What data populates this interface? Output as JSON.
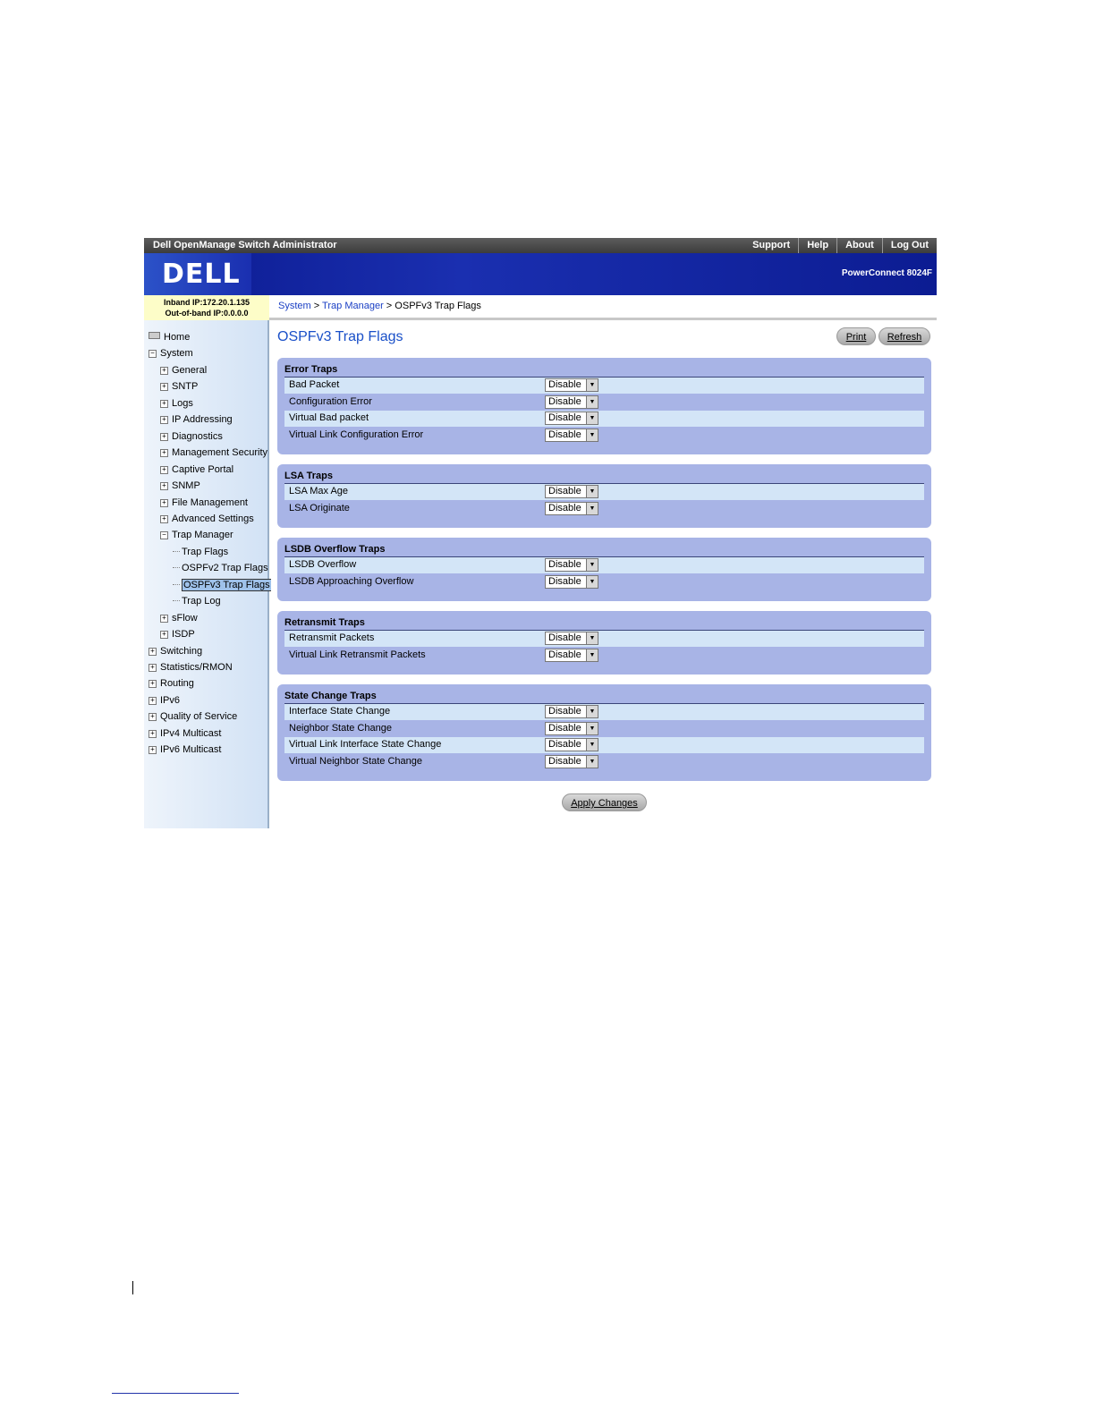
{
  "topbar": {
    "title": "Dell OpenManage Switch Administrator",
    "links": [
      "Support",
      "Help",
      "About",
      "Log Out"
    ]
  },
  "banner": {
    "logo": "DELL",
    "model": "PowerConnect 8024F"
  },
  "ip": {
    "inband": "Inband IP:172.20.1.135",
    "outofband": "Out-of-band IP:0.0.0.0"
  },
  "breadcrumb": {
    "items": [
      "System",
      "Trap Manager",
      "OSPFv3 Trap Flags"
    ],
    "separator": ">"
  },
  "nav": {
    "items": [
      {
        "label": "Home",
        "level": 0,
        "icon": "home-icon"
      },
      {
        "label": "System",
        "level": 0,
        "expanded": true
      },
      {
        "label": "General",
        "level": 1
      },
      {
        "label": "SNTP",
        "level": 1
      },
      {
        "label": "Logs",
        "level": 1
      },
      {
        "label": "IP Addressing",
        "level": 1
      },
      {
        "label": "Diagnostics",
        "level": 1
      },
      {
        "label": "Management Security",
        "level": 1
      },
      {
        "label": "Captive Portal",
        "level": 1
      },
      {
        "label": "SNMP",
        "level": 1
      },
      {
        "label": "File Management",
        "level": 1
      },
      {
        "label": "Advanced Settings",
        "level": 1
      },
      {
        "label": "Trap Manager",
        "level": 1,
        "expanded": true
      },
      {
        "label": "Trap Flags",
        "level": 2
      },
      {
        "label": "OSPFv2 Trap Flags",
        "level": 2
      },
      {
        "label": "OSPFv3 Trap Flags",
        "level": 2,
        "selected": true
      },
      {
        "label": "Trap Log",
        "level": 2
      },
      {
        "label": "sFlow",
        "level": 1
      },
      {
        "label": "ISDP",
        "level": 1
      },
      {
        "label": "Switching",
        "level": 0
      },
      {
        "label": "Statistics/RMON",
        "level": 0
      },
      {
        "label": "Routing",
        "level": 0
      },
      {
        "label": "IPv6",
        "level": 0
      },
      {
        "label": "Quality of Service",
        "level": 0
      },
      {
        "label": "IPv4 Multicast",
        "level": 0
      },
      {
        "label": "IPv6 Multicast",
        "level": 0
      }
    ]
  },
  "page": {
    "title": "OSPFv3 Trap Flags",
    "print_label": "Print",
    "refresh_label": "Refresh",
    "apply_label": "Apply Changes"
  },
  "sections": [
    {
      "title": "Error Traps",
      "rows": [
        {
          "label": "Bad Packet",
          "value": "Disable"
        },
        {
          "label": "Configuration Error",
          "value": "Disable"
        },
        {
          "label": "Virtual Bad packet",
          "value": "Disable"
        },
        {
          "label": "Virtual Link Configuration Error",
          "value": "Disable"
        }
      ]
    },
    {
      "title": "LSA Traps",
      "rows": [
        {
          "label": "LSA Max Age",
          "value": "Disable"
        },
        {
          "label": "LSA Originate",
          "value": "Disable"
        }
      ]
    },
    {
      "title": "LSDB Overflow Traps",
      "rows": [
        {
          "label": "LSDB Overflow",
          "value": "Disable"
        },
        {
          "label": "LSDB Approaching Overflow",
          "value": "Disable"
        }
      ]
    },
    {
      "title": "Retransmit Traps",
      "rows": [
        {
          "label": "Retransmit Packets",
          "value": "Disable"
        },
        {
          "label": "Virtual Link Retransmit Packets",
          "value": "Disable"
        }
      ]
    },
    {
      "title": "State Change Traps",
      "rows": [
        {
          "label": "Interface State Change",
          "value": "Disable"
        },
        {
          "label": "Neighbor State Change",
          "value": "Disable"
        },
        {
          "label": "Virtual Link Interface State Change",
          "value": "Disable"
        },
        {
          "label": "Virtual Neighbor State Change",
          "value": "Disable"
        }
      ]
    }
  ],
  "colors": {
    "accent": "#1a50c8",
    "panel": "#a8b4e6",
    "row_alt": "#d3e5f7"
  }
}
